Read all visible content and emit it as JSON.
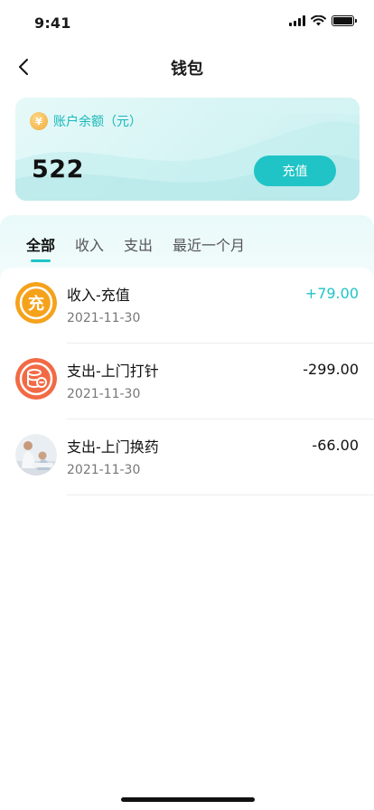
{
  "status_bar": {
    "time": "9:41"
  },
  "nav": {
    "title": "钱包"
  },
  "balance_card": {
    "label": "账户余额（元）",
    "amount": "522",
    "recharge_label": "充值",
    "coin_glyph": "¥"
  },
  "tabs": [
    {
      "label": "全部",
      "active": true
    },
    {
      "label": "收入",
      "active": false
    },
    {
      "label": "支出",
      "active": false
    },
    {
      "label": "最近一个月",
      "active": false
    }
  ],
  "transactions": [
    {
      "title": "收入-充值",
      "date": "2021-11-30",
      "amount": "+79.00",
      "icon": "recharge-icon",
      "icon_glyph": "充"
    },
    {
      "title": "支出-上门打针",
      "date": "2021-11-30",
      "amount": "-299.00",
      "icon": "injection-icon"
    },
    {
      "title": "支出-上门换药",
      "date": "2021-11-30",
      "amount": "-66.00",
      "icon": "nurse-photo"
    }
  ],
  "colors": {
    "accent": "#20c4c6",
    "recharge_icon": "#f5a21b",
    "injection_icon": "#f26a45"
  }
}
